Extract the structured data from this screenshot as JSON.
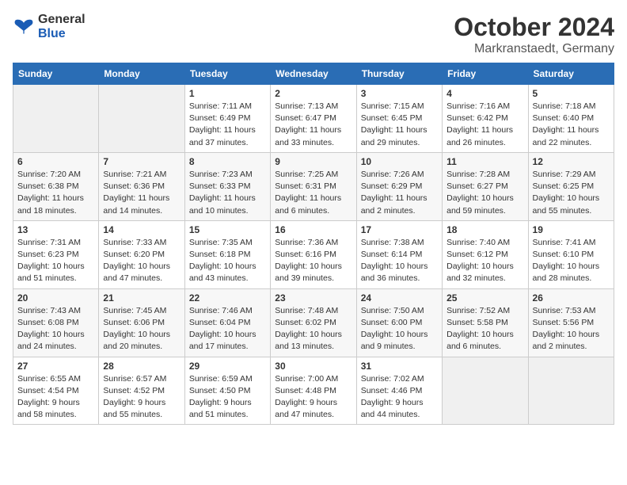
{
  "header": {
    "logo_line1": "General",
    "logo_line2": "Blue",
    "month": "October 2024",
    "location": "Markranstaedt, Germany"
  },
  "days_of_week": [
    "Sunday",
    "Monday",
    "Tuesday",
    "Wednesday",
    "Thursday",
    "Friday",
    "Saturday"
  ],
  "weeks": [
    [
      {
        "day": "",
        "content": ""
      },
      {
        "day": "",
        "content": ""
      },
      {
        "day": "1",
        "content": "Sunrise: 7:11 AM\nSunset: 6:49 PM\nDaylight: 11 hours and 37 minutes."
      },
      {
        "day": "2",
        "content": "Sunrise: 7:13 AM\nSunset: 6:47 PM\nDaylight: 11 hours and 33 minutes."
      },
      {
        "day": "3",
        "content": "Sunrise: 7:15 AM\nSunset: 6:45 PM\nDaylight: 11 hours and 29 minutes."
      },
      {
        "day": "4",
        "content": "Sunrise: 7:16 AM\nSunset: 6:42 PM\nDaylight: 11 hours and 26 minutes."
      },
      {
        "day": "5",
        "content": "Sunrise: 7:18 AM\nSunset: 6:40 PM\nDaylight: 11 hours and 22 minutes."
      }
    ],
    [
      {
        "day": "6",
        "content": "Sunrise: 7:20 AM\nSunset: 6:38 PM\nDaylight: 11 hours and 18 minutes."
      },
      {
        "day": "7",
        "content": "Sunrise: 7:21 AM\nSunset: 6:36 PM\nDaylight: 11 hours and 14 minutes."
      },
      {
        "day": "8",
        "content": "Sunrise: 7:23 AM\nSunset: 6:33 PM\nDaylight: 11 hours and 10 minutes."
      },
      {
        "day": "9",
        "content": "Sunrise: 7:25 AM\nSunset: 6:31 PM\nDaylight: 11 hours and 6 minutes."
      },
      {
        "day": "10",
        "content": "Sunrise: 7:26 AM\nSunset: 6:29 PM\nDaylight: 11 hours and 2 minutes."
      },
      {
        "day": "11",
        "content": "Sunrise: 7:28 AM\nSunset: 6:27 PM\nDaylight: 10 hours and 59 minutes."
      },
      {
        "day": "12",
        "content": "Sunrise: 7:29 AM\nSunset: 6:25 PM\nDaylight: 10 hours and 55 minutes."
      }
    ],
    [
      {
        "day": "13",
        "content": "Sunrise: 7:31 AM\nSunset: 6:23 PM\nDaylight: 10 hours and 51 minutes."
      },
      {
        "day": "14",
        "content": "Sunrise: 7:33 AM\nSunset: 6:20 PM\nDaylight: 10 hours and 47 minutes."
      },
      {
        "day": "15",
        "content": "Sunrise: 7:35 AM\nSunset: 6:18 PM\nDaylight: 10 hours and 43 minutes."
      },
      {
        "day": "16",
        "content": "Sunrise: 7:36 AM\nSunset: 6:16 PM\nDaylight: 10 hours and 39 minutes."
      },
      {
        "day": "17",
        "content": "Sunrise: 7:38 AM\nSunset: 6:14 PM\nDaylight: 10 hours and 36 minutes."
      },
      {
        "day": "18",
        "content": "Sunrise: 7:40 AM\nSunset: 6:12 PM\nDaylight: 10 hours and 32 minutes."
      },
      {
        "day": "19",
        "content": "Sunrise: 7:41 AM\nSunset: 6:10 PM\nDaylight: 10 hours and 28 minutes."
      }
    ],
    [
      {
        "day": "20",
        "content": "Sunrise: 7:43 AM\nSunset: 6:08 PM\nDaylight: 10 hours and 24 minutes."
      },
      {
        "day": "21",
        "content": "Sunrise: 7:45 AM\nSunset: 6:06 PM\nDaylight: 10 hours and 20 minutes."
      },
      {
        "day": "22",
        "content": "Sunrise: 7:46 AM\nSunset: 6:04 PM\nDaylight: 10 hours and 17 minutes."
      },
      {
        "day": "23",
        "content": "Sunrise: 7:48 AM\nSunset: 6:02 PM\nDaylight: 10 hours and 13 minutes."
      },
      {
        "day": "24",
        "content": "Sunrise: 7:50 AM\nSunset: 6:00 PM\nDaylight: 10 hours and 9 minutes."
      },
      {
        "day": "25",
        "content": "Sunrise: 7:52 AM\nSunset: 5:58 PM\nDaylight: 10 hours and 6 minutes."
      },
      {
        "day": "26",
        "content": "Sunrise: 7:53 AM\nSunset: 5:56 PM\nDaylight: 10 hours and 2 minutes."
      }
    ],
    [
      {
        "day": "27",
        "content": "Sunrise: 6:55 AM\nSunset: 4:54 PM\nDaylight: 9 hours and 58 minutes."
      },
      {
        "day": "28",
        "content": "Sunrise: 6:57 AM\nSunset: 4:52 PM\nDaylight: 9 hours and 55 minutes."
      },
      {
        "day": "29",
        "content": "Sunrise: 6:59 AM\nSunset: 4:50 PM\nDaylight: 9 hours and 51 minutes."
      },
      {
        "day": "30",
        "content": "Sunrise: 7:00 AM\nSunset: 4:48 PM\nDaylight: 9 hours and 47 minutes."
      },
      {
        "day": "31",
        "content": "Sunrise: 7:02 AM\nSunset: 4:46 PM\nDaylight: 9 hours and 44 minutes."
      },
      {
        "day": "",
        "content": ""
      },
      {
        "day": "",
        "content": ""
      }
    ]
  ]
}
